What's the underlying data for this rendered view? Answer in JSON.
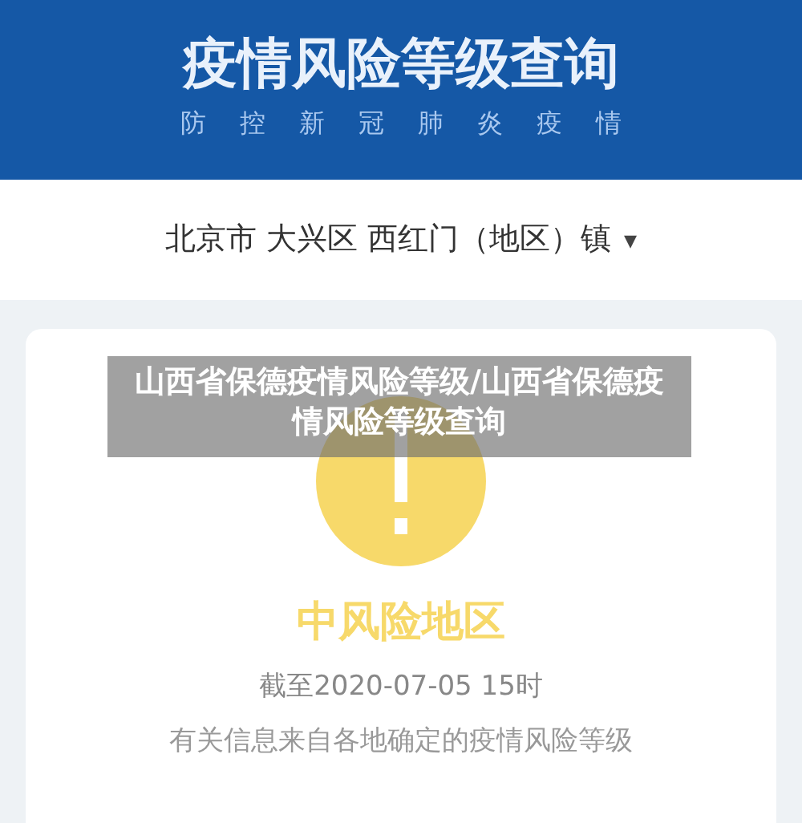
{
  "header": {
    "title": "疫情风险等级查询",
    "subtitle": "防控新冠肺炎疫情"
  },
  "location": {
    "text": "北京市 大兴区 西红门（地区）镇",
    "caret": "▾"
  },
  "result": {
    "kind": "medium",
    "label": "中风险地区",
    "as_of": "截至2020-07-05 15时",
    "note": "有关信息来自各地确定的疫情风险等级"
  },
  "caption": {
    "text": "山西省保德疫情风险等级/山西省保德疫情风险等级查询"
  }
}
